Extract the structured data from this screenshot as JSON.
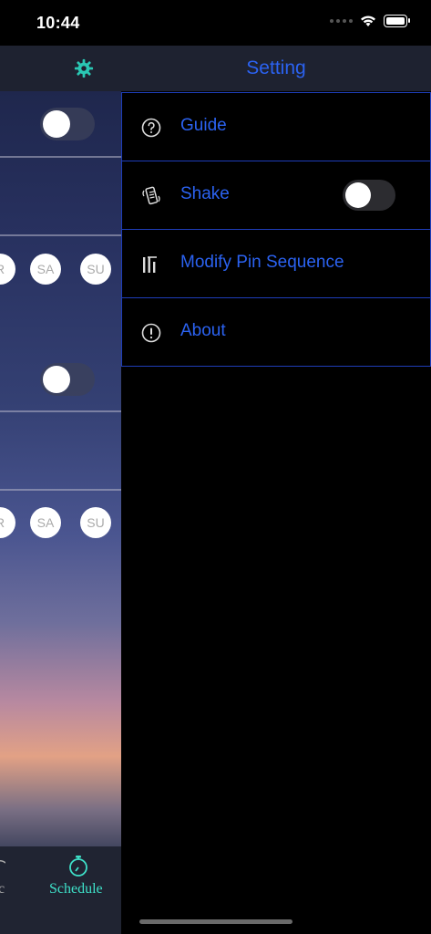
{
  "status_bar": {
    "time": "10:44"
  },
  "left_screen": {
    "days_row_1": [
      "R",
      "SA",
      "SU"
    ],
    "days_row_2": [
      "R",
      "SA",
      "SU"
    ],
    "tabs": [
      {
        "label": "c",
        "active": false
      },
      {
        "label": "Schedule",
        "active": true
      }
    ],
    "toggle_states": [
      false,
      false
    ]
  },
  "drawer": {
    "title": "Setting",
    "items": [
      {
        "label": "Guide",
        "icon": "question-circle-icon"
      },
      {
        "label": "Shake",
        "icon": "shake-phone-icon",
        "toggle": false
      },
      {
        "label": "Modify Pin Sequence",
        "icon": "pin-sequence-icon"
      },
      {
        "label": "About",
        "icon": "exclamation-circle-icon"
      }
    ]
  },
  "colors": {
    "accent_blue": "#2b62f0",
    "border_blue": "#1e3db8",
    "teal": "#3ee0c8"
  }
}
